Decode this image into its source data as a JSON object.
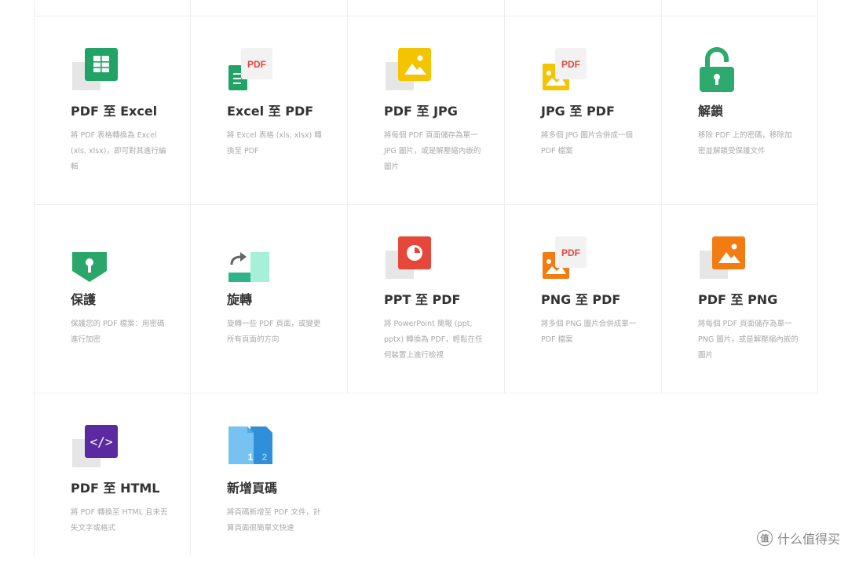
{
  "tools": [
    {
      "id": "pdf-to-excel",
      "title": "PDF 至 Excel",
      "desc": "將 PDF 表格轉換為 Excel (xls, xlsx)，即可對其進行編輯"
    },
    {
      "id": "excel-to-pdf",
      "title": "Excel 至 PDF",
      "desc": "將 Excel 表格 (xls, xlsx) 轉換至 PDF"
    },
    {
      "id": "pdf-to-jpg",
      "title": "PDF 至 JPG",
      "desc": "將每個 PDF 頁面儲存為單一 JPG 圖片，或是解壓縮內嵌的圖片"
    },
    {
      "id": "jpg-to-pdf",
      "title": "JPG 至 PDF",
      "desc": "將多個 JPG 圖片合併成一個 PDF 檔案"
    },
    {
      "id": "unlock",
      "title": "解鎖",
      "desc": "移除 PDF 上的密碼，移除加密並解鎖受保護文件"
    },
    {
      "id": "protect",
      "title": "保護",
      "desc": "保護您的 PDF 檔案：用密碼進行加密"
    },
    {
      "id": "rotate",
      "title": "旋轉",
      "desc": "旋轉一些 PDF 頁面，或變更所有頁面的方向"
    },
    {
      "id": "ppt-to-pdf",
      "title": "PPT 至 PDF",
      "desc": "將 PowerPoint 簡報 (ppt, pptx) 轉換為 PDF，輕鬆在任何裝置上進行檢視"
    },
    {
      "id": "png-to-pdf",
      "title": "PNG 至 PDF",
      "desc": "將多個 PNG 圖片合併成單一 PDF 檔案"
    },
    {
      "id": "pdf-to-png",
      "title": "PDF 至 PNG",
      "desc": "將每個 PDF 頁面儲存為單一 PNG 圖片，或是解壓縮內嵌的圖片"
    },
    {
      "id": "pdf-to-html",
      "title": "PDF 至 HTML",
      "desc": "將 PDF 轉換至 HTML 且未丟失文字或格式"
    },
    {
      "id": "add-page-numbers",
      "title": "新增頁碼",
      "desc": "將頁碼新增至 PDF 文件，計算頁面很簡單文快速"
    }
  ],
  "icon_text": {
    "pdf_badge": "PDF",
    "code_glyph": "</>",
    "page_num_1": "1",
    "page_num_2": "2"
  },
  "watermark": {
    "text": "什么值得买",
    "icon_glyph": "值"
  },
  "colors": {
    "excel_green": "#21a366",
    "jpg_yellow": "#f5c400",
    "pdf_red": "#e8453c",
    "lock_green": "#2eaa6e",
    "shield_green": "#2aa66a",
    "rotate_teal": "#2fb38a",
    "rotate_mint": "#a6efd8",
    "ppt_red": "#e5473b",
    "png_orange": "#f27c12",
    "html_purple": "#5b2aa1",
    "blue_light": "#77c2f0",
    "blue_dark": "#2f8fd8",
    "title_text": "#333333",
    "desc_text": "#aaaaaa",
    "grid_line": "#eeeeee"
  }
}
